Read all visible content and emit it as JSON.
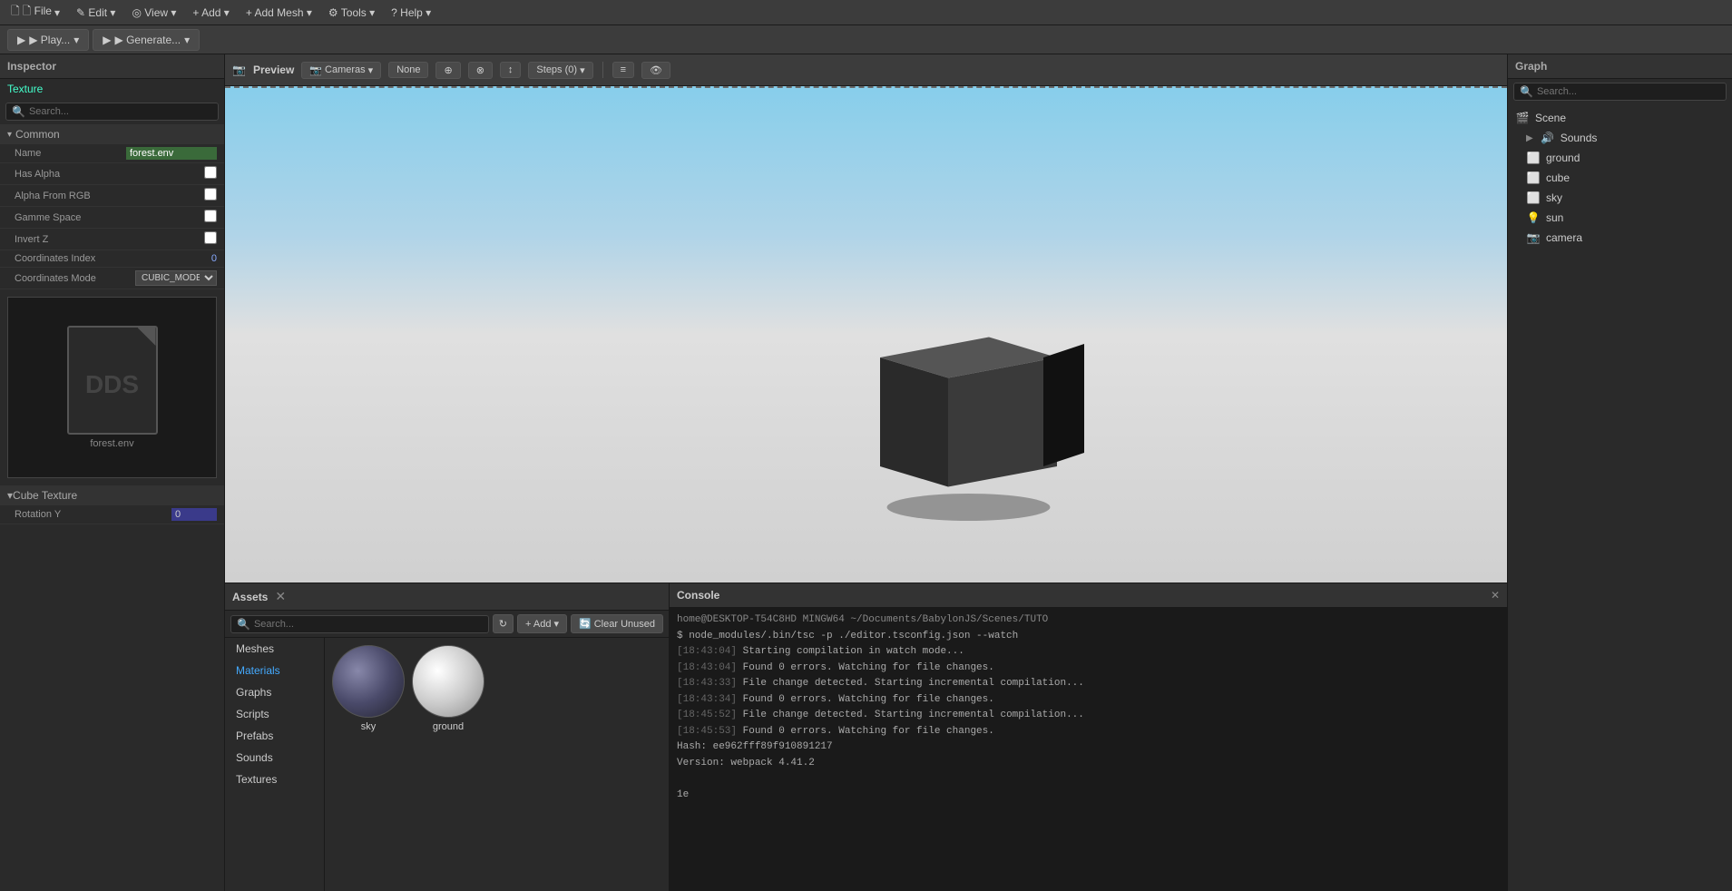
{
  "menubar": {
    "items": [
      {
        "label": "🗋 File",
        "id": "file"
      },
      {
        "label": "✎ Edit",
        "id": "edit"
      },
      {
        "label": "◎ View",
        "id": "view"
      },
      {
        "label": "+ Add",
        "id": "add"
      },
      {
        "label": "+ Add Mesh",
        "id": "add-mesh"
      },
      {
        "label": "⚙ Tools",
        "id": "tools"
      },
      {
        "label": "? Help",
        "id": "help"
      }
    ]
  },
  "toolbar": {
    "play_label": "▶ Play...",
    "generate_label": "▶ Generate..."
  },
  "inspector": {
    "title": "Inspector",
    "section_label": "Texture",
    "search_placeholder": "Search...",
    "common_label": "Common",
    "props": [
      {
        "label": "Name",
        "value": "forest.env",
        "type": "text-green"
      },
      {
        "label": "Has Alpha",
        "value": "",
        "type": "checkbox"
      },
      {
        "label": "Alpha From RGB",
        "value": "",
        "type": "checkbox"
      },
      {
        "label": "Gamme Space",
        "value": "",
        "type": "checkbox"
      },
      {
        "label": "Invert Z",
        "value": "",
        "type": "checkbox"
      },
      {
        "label": "Coordinates Index",
        "value": "0",
        "type": "text-blue"
      },
      {
        "label": "Coordinates Mode",
        "value": "CUBIC_MODE",
        "type": "select"
      }
    ],
    "file_label": "forest.env",
    "cube_texture_label": "Cube Texture",
    "rotation_y_label": "Rotation Y",
    "rotation_y_value": "0"
  },
  "preview": {
    "title": "Preview",
    "cameras_label": "Cameras",
    "none_label": "None",
    "steps_label": "Steps (0)"
  },
  "assets": {
    "title": "Assets",
    "search_placeholder": "Search...",
    "add_label": "+ Add",
    "clear_unused_label": "🔄 Clear Unused",
    "nav_items": [
      {
        "label": "Meshes",
        "id": "meshes"
      },
      {
        "label": "Materials",
        "id": "materials",
        "active": true
      },
      {
        "label": "Graphs",
        "id": "graphs"
      },
      {
        "label": "Scripts",
        "id": "scripts"
      },
      {
        "label": "Prefabs",
        "id": "prefabs"
      },
      {
        "label": "Sounds",
        "id": "sounds"
      },
      {
        "label": "Textures",
        "id": "textures"
      }
    ],
    "materials": [
      {
        "name": "sky",
        "type": "dark-sphere"
      },
      {
        "name": "ground",
        "type": "light-sphere"
      }
    ]
  },
  "console": {
    "title": "Console",
    "lines": [
      {
        "text": "home@DESKTOP-T54C8HD MINGW64 ~/Documents/BabylonJS/Scenes/TUTO"
      },
      {
        "text": "$ node_modules/.bin/tsc -p ./editor.tsconfig.json --watch"
      },
      {
        "timestamp": "[18:43:04]",
        "text": " Starting compilation in watch mode..."
      },
      {
        "timestamp": "[18:43:04]",
        "text": " Found 0 errors. Watching for file changes."
      },
      {
        "timestamp": "[18:43:33]",
        "text": " File change detected. Starting incremental compilation..."
      },
      {
        "timestamp": "[18:43:34]",
        "text": " Found 0 errors. Watching for file changes."
      },
      {
        "timestamp": "[18:45:52]",
        "text": " File change detected. Starting incremental compilation..."
      },
      {
        "timestamp": "[18:45:53]",
        "text": " Found 0 errors. Watching for file changes."
      },
      {
        "text": "Hash: ee962fff89f910891217"
      },
      {
        "text": "Version: webpack 4.41.2"
      },
      {
        "text": ""
      },
      {
        "text": "1e"
      }
    ]
  },
  "graph": {
    "title": "Graph",
    "search_placeholder": "Search...",
    "tree": [
      {
        "label": "Scene",
        "icon": "🎬",
        "indent": 0,
        "has_arrow": false
      },
      {
        "label": "Sounds",
        "icon": "🔊",
        "indent": 1,
        "has_arrow": true
      },
      {
        "label": "ground",
        "icon": "⬜",
        "indent": 1,
        "has_arrow": false
      },
      {
        "label": "cube",
        "icon": "⬜",
        "indent": 1,
        "has_arrow": false
      },
      {
        "label": "sky",
        "icon": "⬜",
        "indent": 1,
        "has_arrow": false
      },
      {
        "label": "sun",
        "icon": "💡",
        "indent": 1,
        "has_arrow": false
      },
      {
        "label": "camera",
        "icon": "📷",
        "indent": 1,
        "has_arrow": false
      }
    ]
  }
}
